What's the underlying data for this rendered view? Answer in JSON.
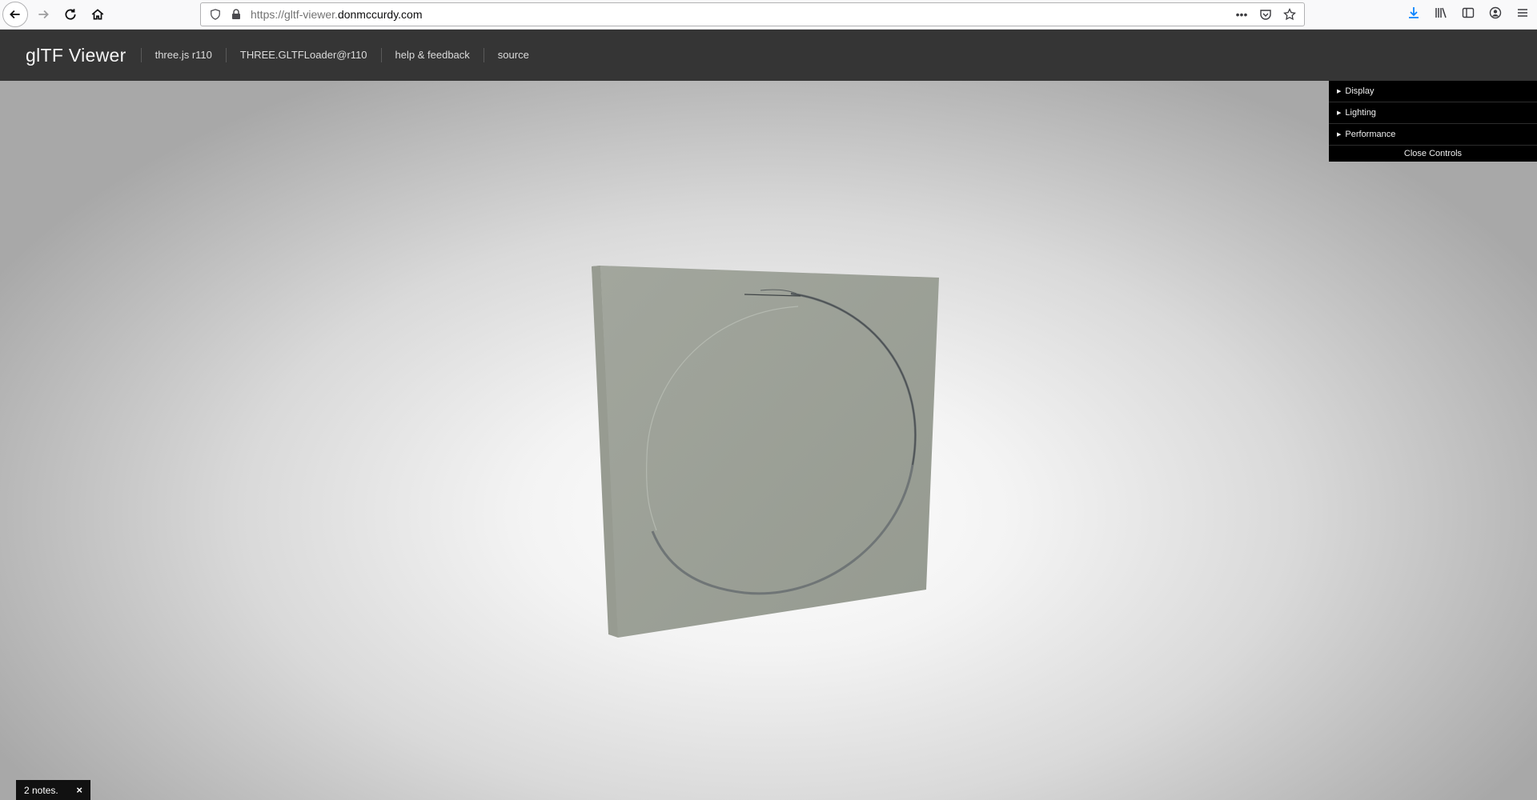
{
  "browser": {
    "url_prefix": "https://gltf-viewer.",
    "url_domain": "donmccurdy.com",
    "colors": {
      "download_icon": "#0a84ff"
    }
  },
  "header": {
    "title": "glTF Viewer",
    "nav": [
      {
        "label": "three.js r110"
      },
      {
        "label": "THREE.GLTFLoader@r110"
      },
      {
        "label": "help & feedback"
      },
      {
        "label": "source"
      }
    ]
  },
  "controls": {
    "folders": [
      {
        "label": "Display"
      },
      {
        "label": "Lighting"
      },
      {
        "label": "Performance"
      }
    ],
    "close_label": "Close Controls"
  },
  "notes": {
    "label": "2 notes.",
    "close_glyph": "×"
  }
}
